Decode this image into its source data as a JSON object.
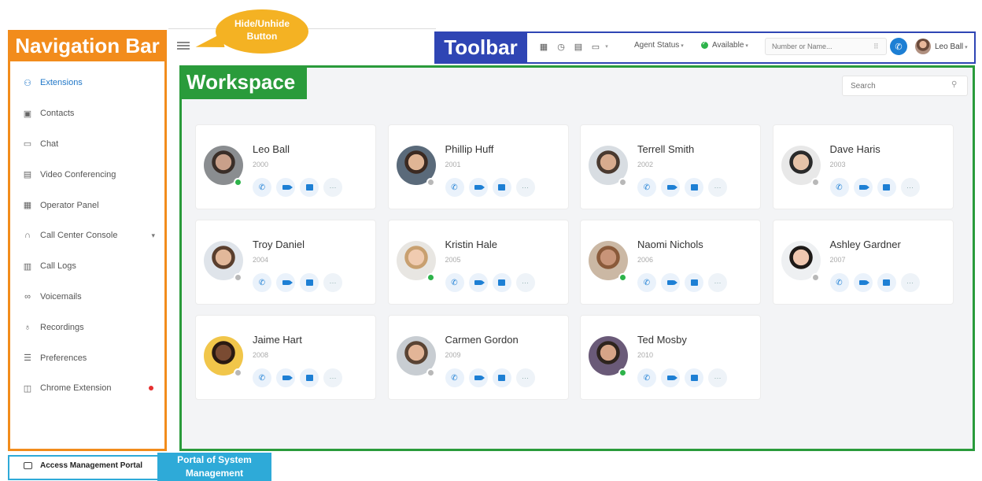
{
  "annotations": {
    "navigation_bar": "Navigation Bar",
    "toolbar": "Toolbar",
    "workspace": "Workspace",
    "hide_button": "Hide/Unhide Button",
    "portal": "Portal of System Management"
  },
  "sidebar": {
    "items": [
      {
        "label": "Extensions",
        "icon": "users-icon",
        "active": true
      },
      {
        "label": "Contacts",
        "icon": "contacts-icon"
      },
      {
        "label": "Chat",
        "icon": "chat-icon"
      },
      {
        "label": "Video Conferencing",
        "icon": "video-icon"
      },
      {
        "label": "Operator Panel",
        "icon": "operator-icon"
      },
      {
        "label": "Call Center Console",
        "icon": "headset-icon"
      },
      {
        "label": "Call Logs",
        "icon": "call-logs-icon"
      },
      {
        "label": "Voicemails",
        "icon": "voicemail-icon"
      },
      {
        "label": "Recordings",
        "icon": "microphone-icon"
      },
      {
        "label": "Preferences",
        "icon": "preferences-icon"
      },
      {
        "label": "Chrome Extension",
        "icon": "extension-icon"
      }
    ],
    "bottom_link": "Access Management Portal"
  },
  "toolbar": {
    "agent_status": "Agent Status",
    "availability": "Available",
    "number_placeholder": "Number or Name...",
    "user_name": "Leo Ball"
  },
  "workspace": {
    "search_placeholder": "Search",
    "status_colors": {
      "online": "#2db34a",
      "offline": "#b8b8b8"
    },
    "extensions": [
      {
        "name": "Leo Ball",
        "ext": "2000",
        "status": "online"
      },
      {
        "name": "Phillip Huff",
        "ext": "2001",
        "status": "offline"
      },
      {
        "name": "Terrell Smith",
        "ext": "2002",
        "status": "offline"
      },
      {
        "name": "Dave Haris",
        "ext": "2003",
        "status": "offline"
      },
      {
        "name": "Troy Daniel",
        "ext": "2004",
        "status": "offline"
      },
      {
        "name": "Kristin Hale",
        "ext": "2005",
        "status": "online"
      },
      {
        "name": "Naomi Nichols",
        "ext": "2006",
        "status": "online"
      },
      {
        "name": "Ashley Gardner",
        "ext": "2007",
        "status": "offline"
      },
      {
        "name": "Jaime Hart",
        "ext": "2008",
        "status": "offline"
      },
      {
        "name": "Carmen Gordon",
        "ext": "2009",
        "status": "offline"
      },
      {
        "name": "Ted Mosby",
        "ext": "2010",
        "status": "online"
      }
    ]
  }
}
